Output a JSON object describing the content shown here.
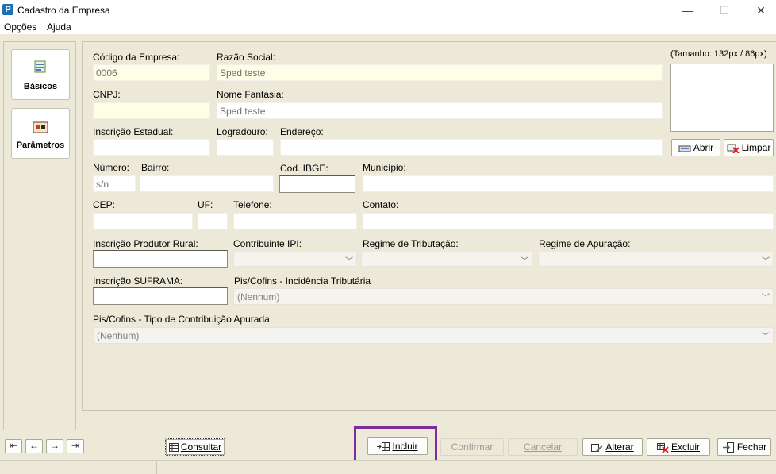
{
  "window": {
    "title": "Cadastro da Empresa",
    "controls": {
      "minimize": "—",
      "maximize": "☐",
      "close": "✕"
    }
  },
  "menu": {
    "items": [
      "Opções",
      "Ajuda"
    ]
  },
  "nav": {
    "basicos": "Básicos",
    "parametros": "Parâmetros"
  },
  "form": {
    "codigo_label": "Código da Empresa:",
    "codigo_value": "0006",
    "razao_label": "Razão Social:",
    "razao_value": "Sped teste",
    "cnpj_label": "CNPJ:",
    "cnpj_value": "",
    "fantasia_label": "Nome Fantasia:",
    "fantasia_value": "Sped teste",
    "ie_label": "Inscrição Estadual:",
    "logradouro_label": "Logradouro:",
    "endereco_label": "Endereço:",
    "numero_label": "Número:",
    "numero_value": "s/n",
    "bairro_label": "Bairro:",
    "ibge_label": "Cod. IBGE:",
    "municipio_label": "Município:",
    "cep_label": "CEP:",
    "uf_label": "UF:",
    "telefone_label": "Telefone:",
    "contato_label": "Contato:",
    "ipr_label": "Inscrição Produtor Rural:",
    "ipi_label": "Contribuinte IPI:",
    "trib_label": "Regime de Tributação:",
    "apur_label": "Regime de Apuração:",
    "suframa_label": "Inscrição SUFRAMA:",
    "piscofins_inc_label": "Pis/Cofins - Incidência Tributária",
    "piscofins_inc_value": "(Nenhum)",
    "piscofins_tipo_label": "Pis/Cofins - Tipo de Contribuição Apurada",
    "piscofins_tipo_value": "(Nenhum)"
  },
  "photo": {
    "size_label": "(Tamanho: 132px / 86px)",
    "abrir": "Abrir",
    "limpar": "Limpar"
  },
  "footer": {
    "consultar": "Consultar",
    "incluir": "Incluir",
    "confirmar": "Confirmar",
    "cancelar": "Cancelar",
    "alterar": "Alterar",
    "excluir": "Excluir",
    "fechar": "Fechar",
    "nav_arrows": [
      "⇤",
      "←",
      "→",
      "⇥"
    ]
  }
}
